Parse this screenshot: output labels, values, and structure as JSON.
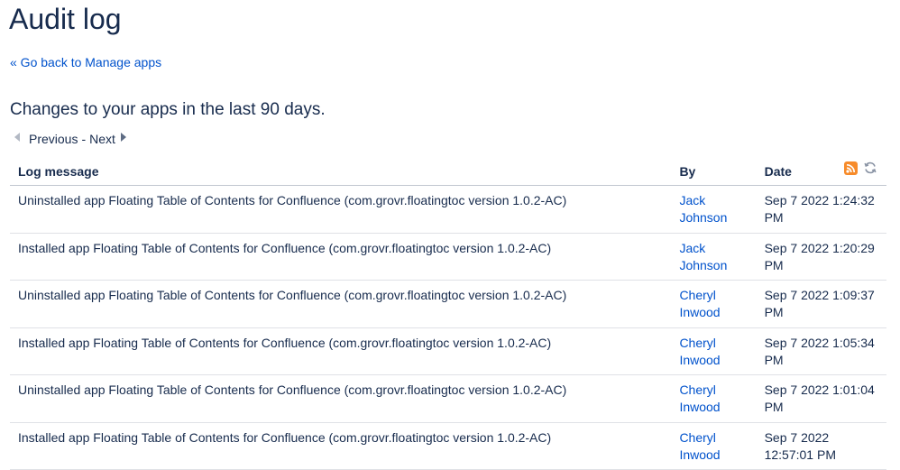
{
  "page": {
    "title": "Audit log",
    "back_link": "« Go back to Manage apps",
    "subtitle": "Changes to your apps in the last 90 days."
  },
  "pager": {
    "previous": "Previous",
    "separator": "-",
    "next": "Next"
  },
  "table": {
    "headers": {
      "message": "Log message",
      "by": "By",
      "date": "Date"
    },
    "icons": [
      "rss-feed-icon",
      "refresh-icon"
    ],
    "rows": [
      {
        "message": "Uninstalled app Floating Table of Contents for Confluence (com.grovr.floatingtoc version 1.0.2-AC)",
        "by": "Jack Johnson",
        "date": "Sep 7 2022 1:24:32 PM"
      },
      {
        "message": "Installed app Floating Table of Contents for Confluence (com.grovr.floatingtoc version 1.0.2-AC)",
        "by": "Jack Johnson",
        "date": "Sep 7 2022 1:20:29 PM"
      },
      {
        "message": "Uninstalled app Floating Table of Contents for Confluence (com.grovr.floatingtoc version 1.0.2-AC)",
        "by": "Cheryl Inwood",
        "date": "Sep 7 2022 1:09:37 PM"
      },
      {
        "message": "Installed app Floating Table of Contents for Confluence (com.grovr.floatingtoc version 1.0.2-AC)",
        "by": "Cheryl Inwood",
        "date": "Sep 7 2022 1:05:34 PM"
      },
      {
        "message": "Uninstalled app Floating Table of Contents for Confluence (com.grovr.floatingtoc version 1.0.2-AC)",
        "by": "Cheryl Inwood",
        "date": "Sep 7 2022 1:01:04 PM"
      },
      {
        "message": "Installed app Floating Table of Contents for Confluence (com.grovr.floatingtoc version 1.0.2-AC)",
        "by": "Cheryl Inwood",
        "date": "Sep 7 2022 12:57:01 PM"
      }
    ]
  },
  "colors": {
    "link": "#0052cc",
    "text": "#172b4d",
    "rss": "#f78b2a"
  }
}
